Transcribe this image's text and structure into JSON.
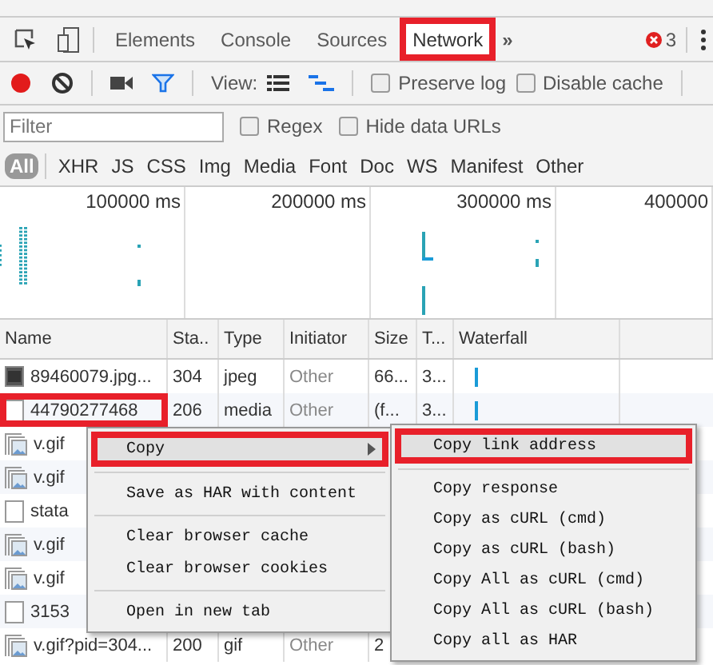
{
  "devtools_tabs": [
    {
      "label": "Elements",
      "selected": false,
      "highlighted": false
    },
    {
      "label": "Console",
      "selected": false,
      "highlighted": false
    },
    {
      "label": "Sources",
      "selected": false,
      "highlighted": false
    },
    {
      "label": "Network",
      "selected": true,
      "highlighted": true
    }
  ],
  "more_tabs": "»",
  "error_count": "3",
  "toolbar": {
    "recording": true,
    "view_label": "View:",
    "options": [
      {
        "label": "Preserve log",
        "checked": false
      },
      {
        "label": "Disable cache",
        "checked": false
      }
    ]
  },
  "filter": {
    "placeholder": "Filter",
    "options": [
      {
        "label": "Regex",
        "checked": false
      },
      {
        "label": "Hide data URLs",
        "checked": false
      }
    ]
  },
  "type_filters": [
    {
      "label": "All",
      "selected": true
    },
    {
      "label": "XHR",
      "selected": false
    },
    {
      "label": "JS",
      "selected": false
    },
    {
      "label": "CSS",
      "selected": false
    },
    {
      "label": "Img",
      "selected": false
    },
    {
      "label": "Media",
      "selected": false
    },
    {
      "label": "Font",
      "selected": false
    },
    {
      "label": "Doc",
      "selected": false
    },
    {
      "label": "WS",
      "selected": false
    },
    {
      "label": "Manifest",
      "selected": false
    },
    {
      "label": "Other",
      "selected": false
    }
  ],
  "overview": {
    "ticks": [
      "100000 ms",
      "200000 ms",
      "300000 ms",
      "400000"
    ]
  },
  "table": {
    "columns": [
      "Name",
      "Sta..",
      "Type",
      "Initiator",
      "Size",
      "T...",
      "Waterfall"
    ],
    "rows": [
      {
        "kind": "image",
        "cells": [
          "89460079.jpg...",
          "304",
          "jpeg",
          "Other",
          "66...",
          "3..."
        ],
        "highlighted": false
      },
      {
        "kind": "blank",
        "cells": [
          "44790277468",
          "206",
          "media",
          "Other",
          "(f...",
          "3..."
        ],
        "highlighted": true
      },
      {
        "kind": "gif",
        "cells": [
          "v.gif"
        ],
        "highlighted": false
      },
      {
        "kind": "gif",
        "cells": [
          "v.gif"
        ],
        "highlighted": false
      },
      {
        "kind": "blank",
        "cells": [
          "stata"
        ],
        "highlighted": false
      },
      {
        "kind": "gif",
        "cells": [
          "v.gif"
        ],
        "highlighted": false
      },
      {
        "kind": "gif",
        "cells": [
          "v.gif"
        ],
        "highlighted": false
      },
      {
        "kind": "blank",
        "cells": [
          "3153"
        ],
        "highlighted": false
      },
      {
        "kind": "gif",
        "cells": [
          "v.gif?pid=304...",
          "200",
          "gif",
          "Other",
          "2"
        ],
        "highlighted": false
      }
    ]
  },
  "context_menu": {
    "groups": [
      [
        {
          "label": "Copy",
          "submenu": true,
          "selected": true,
          "highlighted": true
        }
      ],
      [
        {
          "label": "Save as HAR with content",
          "submenu": false,
          "selected": false,
          "highlighted": false
        }
      ],
      [
        {
          "label": "Clear browser cache",
          "submenu": false,
          "selected": false,
          "highlighted": false
        },
        {
          "label": "Clear browser cookies",
          "submenu": false,
          "selected": false,
          "highlighted": false
        }
      ],
      [
        {
          "label": "Open in new tab",
          "submenu": false,
          "selected": false,
          "highlighted": false
        }
      ]
    ]
  },
  "submenu": {
    "groups": [
      [
        {
          "label": "Copy link address",
          "selected": true,
          "highlighted": true
        }
      ],
      [
        {
          "label": "Copy response",
          "selected": false,
          "highlighted": false
        },
        {
          "label": "Copy as cURL (cmd)",
          "selected": false,
          "highlighted": false
        },
        {
          "label": "Copy as cURL (bash)",
          "selected": false,
          "highlighted": false
        },
        {
          "label": "Copy All as cURL (cmd)",
          "selected": false,
          "highlighted": false
        },
        {
          "label": "Copy All as cURL (bash)",
          "selected": false,
          "highlighted": false
        },
        {
          "label": "Copy all as HAR",
          "selected": false,
          "highlighted": false
        }
      ]
    ]
  }
}
